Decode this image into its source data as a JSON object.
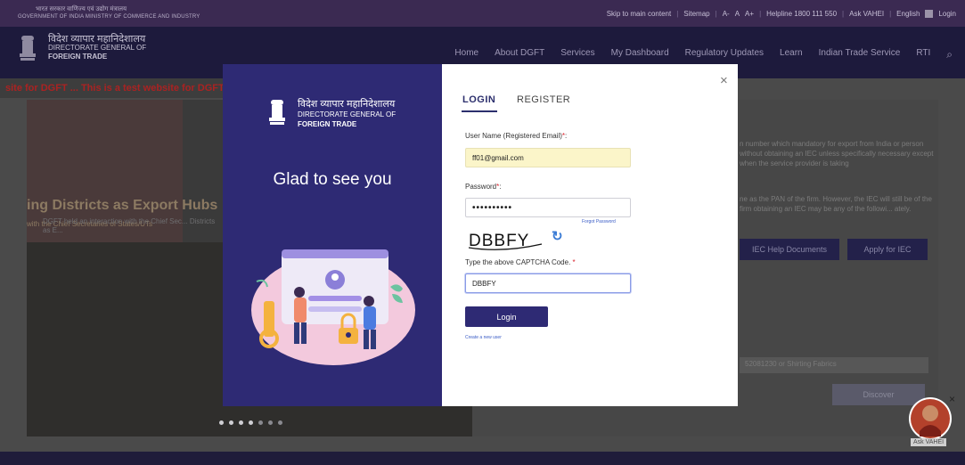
{
  "topbar": {
    "gov_hindi": "भारत सरकार वाणिज्य एवं उद्योग मंत्रालय",
    "gov_english": "GOVERNMENT OF INDIA MINISTRY OF COMMERCE AND INDUSTRY",
    "links": [
      "Skip to main content",
      "Sitemap",
      "A-",
      "A",
      "A+",
      "Helpline 1800 111 550",
      "Ask VAHEI",
      "English",
      "Login"
    ]
  },
  "nav": {
    "logo_hindi": "विदेश व्यापार महानिदेशालय",
    "logo_en1": "DIRECTORATE GENERAL OF",
    "logo_en2": "FOREIGN TRADE",
    "menu": [
      "Home",
      "About DGFT",
      "Services",
      "My Dashboard",
      "Regulatory Updates",
      "Learn",
      "Indian Trade Service",
      "RTI"
    ]
  },
  "background": {
    "marquee": "site for DGFT ... This is a test website for DGFT ...",
    "banner_title": "ing Districts as Export Hubs",
    "banner_sub": "with the Chief Secretaries of States/UTs",
    "slide_caption": "DGFT held an interaction with the Chief Sec... Districts as E...",
    "right_text_1": "n number which mandatory for export from India or person without obtaining an IEC unless specifically necessary except when the service provider is taking",
    "right_text_2": "ne as the PAN of the firm. However, the IEC will still be of the firm obtaining an IEC may be any of the followi... ately.",
    "iec_help": "IEC Help Documents",
    "apply_iec": "Apply for IEC",
    "select_value": "52081230 or Shirting Fabrics",
    "discover": "Discover",
    "ask_vahei": "Ask VAHEI"
  },
  "modal": {
    "logo_hindi": "विदेश व्यापार महानिदेशालय",
    "logo_en1": "DIRECTORATE GENERAL OF",
    "logo_en2": "FOREIGN TRADE",
    "tagline": "Glad to see you",
    "tabs": {
      "login": "LOGIN",
      "register": "REGISTER"
    },
    "username_label": "User Name (Registered Email)",
    "username_value": "ff01@gmail.com",
    "password_label": "Password",
    "password_value": "••••••••••",
    "forgot_password": "Forgot Password",
    "captcha_text": "DBBFY",
    "captcha_label": "Type the above CAPTCHA Code.",
    "captcha_value": "DBBFY",
    "login_button": "Login",
    "create_user": "Create a new user",
    "required_marker": "*",
    "close_glyph": "×",
    "refresh_glyph": "↻"
  }
}
